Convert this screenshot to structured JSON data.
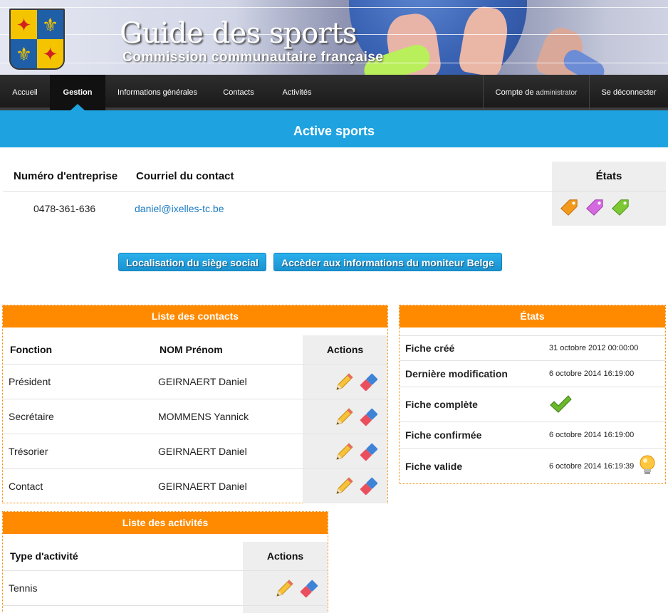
{
  "header": {
    "site_title": "Guide des sports",
    "site_subtitle": "Commission communautaire française",
    "crest_icon": "coat-of-arms-icon"
  },
  "nav": {
    "items": [
      {
        "label": "Accueil"
      },
      {
        "label": "Gestion",
        "active": true
      },
      {
        "label": "Informations générales"
      },
      {
        "label": "Contacts"
      },
      {
        "label": "Activités"
      }
    ],
    "account_prefix": "Compte de",
    "account_user": "administrator",
    "logout_label": "Se déconnecter"
  },
  "page": {
    "title": "Active sports"
  },
  "company": {
    "headers": {
      "number": "Numéro d'entreprise",
      "email": "Courriel du contact",
      "states": "États"
    },
    "number": "0478-361-636",
    "email": "daniel@ixelles-tc.be",
    "state_tags": [
      {
        "icon": "orange-tag-icon",
        "color": "#f39a1e"
      },
      {
        "icon": "purple-tag-icon",
        "color": "#d56ae0"
      },
      {
        "icon": "green-tag-icon",
        "color": "#7cc934"
      }
    ]
  },
  "buttons": {
    "location": "Localisation du siège social",
    "moniteur": "Accèder aux informations du moniteur Belge"
  },
  "contacts": {
    "title": "Liste des contacts",
    "headers": {
      "fonction": "Fonction",
      "nom": "NOM Prénom",
      "actions": "Actions"
    },
    "rows": [
      {
        "fonction": "Président",
        "nom": "GEIRNAERT Daniel"
      },
      {
        "fonction": "Secrétaire",
        "nom": "MOMMENS Yannick"
      },
      {
        "fonction": "Trésorier",
        "nom": "GEIRNAERT Daniel"
      },
      {
        "fonction": "Contact",
        "nom": "GEIRNAERT Daniel"
      }
    ]
  },
  "etats": {
    "title": "États",
    "rows": [
      {
        "label": "Fiche créé",
        "value": "31 octobre 2012 00:00:00"
      },
      {
        "label": "Dernière modification",
        "value": "6 octobre 2014 16:19:00"
      },
      {
        "label": "Fiche complète",
        "value": "",
        "icon": "checkmark-icon"
      },
      {
        "label": "Fiche confirmée",
        "value": "6 octobre 2014 16:19:00"
      },
      {
        "label": "Fiche valide",
        "value": "6 octobre 2014 16:19:39",
        "icon": "lightbulb-icon"
      }
    ]
  },
  "activites": {
    "title": "Liste des activités",
    "headers": {
      "type": "Type d'activité",
      "actions": "Actions"
    },
    "rows": [
      {
        "type": "Tennis"
      }
    ]
  },
  "colors": {
    "accent_blue": "#1fa3e0",
    "panel_orange": "#ff8a00",
    "link_blue": "#1a7bc4"
  }
}
